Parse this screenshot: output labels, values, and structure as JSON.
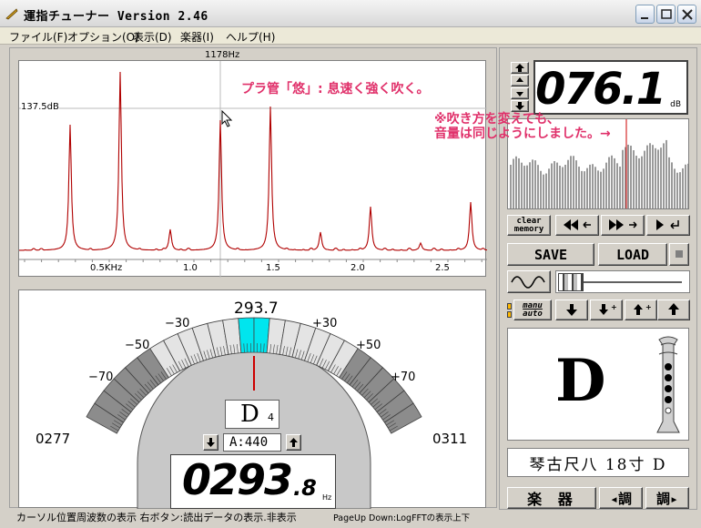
{
  "window": {
    "title": "運指チューナー  Version 2.46",
    "minimize": "minimize",
    "maximize": "maximize",
    "close": "close"
  },
  "menu": [
    {
      "label": "ファイル(F)"
    },
    {
      "label": "オプション(O)"
    },
    {
      "label": "表示(D)"
    },
    {
      "label": "楽器(I)"
    },
    {
      "label": "ヘルプ(H)"
    }
  ],
  "spectrum": {
    "cursor_freq": "1178Hz",
    "cursor_db": "137.5dB",
    "x_ticks": [
      "0.5KHz",
      "1.0",
      "1.5",
      "2.0",
      "2.5"
    ],
    "annotation_1": "プラ管「悠」: 息速く強く吹く。",
    "annotation_2_line1": "※吹き方を変えても、",
    "annotation_2_line2": "音量は同じようにしました。→"
  },
  "tuner": {
    "target_freq": "293.7",
    "cents_labels": [
      "−70",
      "−50",
      "−30",
      "+30",
      "+50",
      "+70"
    ],
    "left_freq": "0277",
    "right_freq": "0311",
    "note": "D",
    "octave": "4",
    "reference": "A:440",
    "frequency_main": "0293",
    "frequency_decimal": ".8",
    "frequency_unit": "Hz"
  },
  "right_panel": {
    "db_value": "076.1",
    "db_unit": "dB",
    "clear_memory": [
      "clear",
      "memory"
    ],
    "save": "SAVE",
    "load": "LOAD",
    "manu_auto": [
      "manu",
      "auto"
    ],
    "note_letter": "D",
    "instrument_name": "琴古尺八 18寸 D",
    "instrument_button": "楽 器",
    "key_down": "◂調",
    "key_up": "調▸"
  },
  "status": {
    "left": "カーソル位置周波数の表示 右ボタン:読出データの表示.非表示",
    "right": "PageUp Down:LogFFTの表示上下"
  },
  "colors": {
    "spectrum_line": "#b00000",
    "highlight_cyan": "#00e5ee",
    "needle": "#cc0000",
    "annotation_pink": "#e0306a"
  }
}
